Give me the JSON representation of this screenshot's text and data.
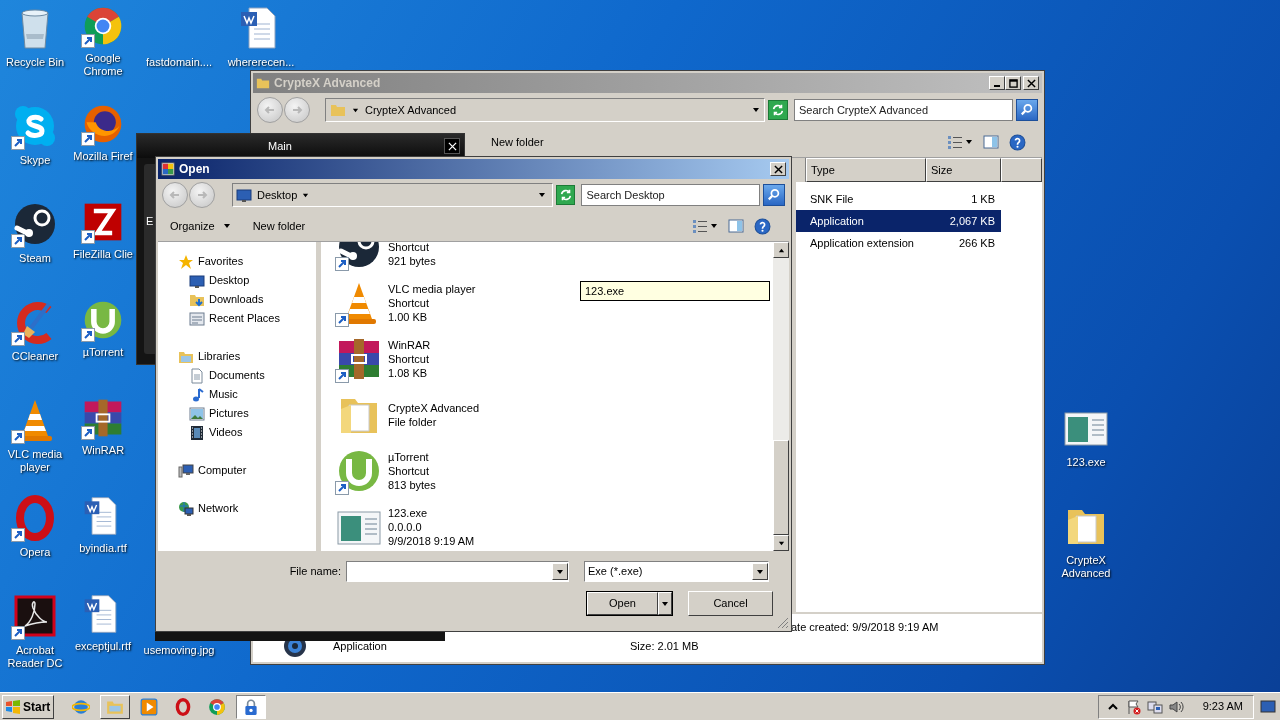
{
  "desktop": {
    "columns": [
      [
        {
          "label": "Recycle Bin",
          "kind": "recycle-bin",
          "shortcut": false
        },
        {
          "label": "Skype",
          "kind": "skype",
          "shortcut": true
        },
        {
          "label": "Steam",
          "kind": "steam",
          "shortcut": true
        },
        {
          "label": "CCleaner",
          "kind": "ccleaner",
          "shortcut": true
        },
        {
          "label": "VLC media player",
          "kind": "vlc",
          "shortcut": true
        },
        {
          "label": "Opera",
          "kind": "opera",
          "shortcut": true
        },
        {
          "label": "Acrobat Reader DC",
          "kind": "acrobat",
          "shortcut": true
        }
      ],
      [
        {
          "label": "Google Chrome",
          "kind": "chrome",
          "shortcut": true
        },
        {
          "label": "Mozilla Firef",
          "kind": "firefox",
          "shortcut": true
        },
        {
          "label": "FileZilla Clie",
          "kind": "filezilla",
          "shortcut": true
        },
        {
          "label": "µTorrent",
          "kind": "utorrent",
          "shortcut": true
        },
        {
          "label": "WinRAR",
          "kind": "winrar",
          "shortcut": true
        },
        {
          "label": "byindia.rtf",
          "kind": "word",
          "shortcut": false
        },
        {
          "label": "exceptjul.rtf",
          "kind": "word",
          "shortcut": false
        }
      ],
      [
        {
          "label": "fastdomain....",
          "kind": "blank",
          "shortcut": false
        },
        {
          "label": "usemoving.jpg",
          "kind": "blank",
          "shortcut": false
        }
      ],
      [
        {
          "label": "whererecen...",
          "kind": "word",
          "shortcut": false
        }
      ]
    ],
    "right_icons": [
      {
        "label": "123.exe",
        "kind": "exe",
        "shortcut": false
      },
      {
        "label": "CrypteX Advanced",
        "kind": "folder",
        "shortcut": false
      }
    ]
  },
  "explorer": {
    "title": "CrypteX Advanced",
    "active": false,
    "address": "CrypteX Advanced",
    "search_placeholder": "Search CrypteX Advanced",
    "toolbar": [
      "New folder"
    ],
    "columns": [
      "Type",
      "Size"
    ],
    "rows": [
      {
        "type": "SNK File",
        "size": "1 KB",
        "selected": false
      },
      {
        "type": "Application",
        "size": "2,067 KB",
        "selected": true
      },
      {
        "type": "Application extension",
        "size": "266 KB",
        "selected": false
      }
    ],
    "details": {
      "created": "ate created: 9/9/2018 9:19 AM",
      "type": "Application",
      "size": "Size: 2.01 MB"
    }
  },
  "main_window": {
    "title": "Main",
    "panel_label": "E"
  },
  "open_dialog": {
    "title": "Open",
    "active": true,
    "location": "Desktop",
    "search_placeholder": "Search Desktop",
    "toolbar": [
      {
        "label": "Organize",
        "menu": true
      },
      {
        "label": "New folder",
        "menu": false
      }
    ],
    "nav": [
      {
        "label": "Favorites",
        "kind": "star",
        "children": [
          {
            "label": "Desktop",
            "kind": "desktop"
          },
          {
            "label": "Downloads",
            "kind": "downloads"
          },
          {
            "label": "Recent Places",
            "kind": "recent"
          }
        ]
      },
      {
        "label": "Libraries",
        "kind": "library",
        "children": [
          {
            "label": "Documents",
            "kind": "document"
          },
          {
            "label": "Music",
            "kind": "music"
          },
          {
            "label": "Pictures",
            "kind": "pictures"
          },
          {
            "label": "Videos",
            "kind": "videos"
          }
        ]
      },
      {
        "label": "Computer",
        "kind": "computer"
      },
      {
        "label": "Network",
        "kind": "network"
      }
    ],
    "files": [
      {
        "kind": "steam",
        "shortcut": true,
        "clipped": true,
        "lines": [
          "Shortcut",
          "921 bytes"
        ]
      },
      {
        "kind": "vlc",
        "shortcut": true,
        "clipped": false,
        "lines": [
          "VLC media player",
          "Shortcut",
          "1.00 KB"
        ]
      },
      {
        "kind": "winrar",
        "shortcut": true,
        "clipped": false,
        "lines": [
          "WinRAR",
          "Shortcut",
          "1.08 KB"
        ]
      },
      {
        "kind": "folder",
        "shortcut": false,
        "clipped": false,
        "lines": [
          "CrypteX Advanced",
          "File folder"
        ]
      },
      {
        "kind": "utorrent",
        "shortcut": true,
        "clipped": false,
        "lines": [
          "µTorrent",
          "Shortcut",
          "813 bytes"
        ]
      },
      {
        "kind": "exe",
        "shortcut": false,
        "clipped": false,
        "lines": [
          "123.exe",
          "0.0.0.0",
          "9/9/2018 9:19 AM"
        ]
      }
    ],
    "tooltip": "123.exe",
    "file_name_label": "File name:",
    "filter": "Exe (*.exe)",
    "buttons": [
      {
        "label": "Open",
        "kind": "split"
      },
      {
        "label": "Cancel",
        "kind": "plain"
      }
    ]
  },
  "taskbar": {
    "start": "Start",
    "items": [
      {
        "kind": "ie",
        "window": false,
        "selected": false
      },
      {
        "kind": "explorer",
        "window": true,
        "selected": false
      },
      {
        "kind": "media",
        "window": false,
        "selected": false
      },
      {
        "kind": "opera",
        "window": false,
        "selected": false
      },
      {
        "kind": "chrome",
        "window": false,
        "selected": false
      },
      {
        "kind": "lock",
        "window": true,
        "selected": true
      }
    ],
    "tray": [
      {
        "kind": "chevron"
      },
      {
        "kind": "flag"
      },
      {
        "kind": "network"
      },
      {
        "kind": "volume"
      }
    ],
    "clock": "9:23 AM"
  }
}
